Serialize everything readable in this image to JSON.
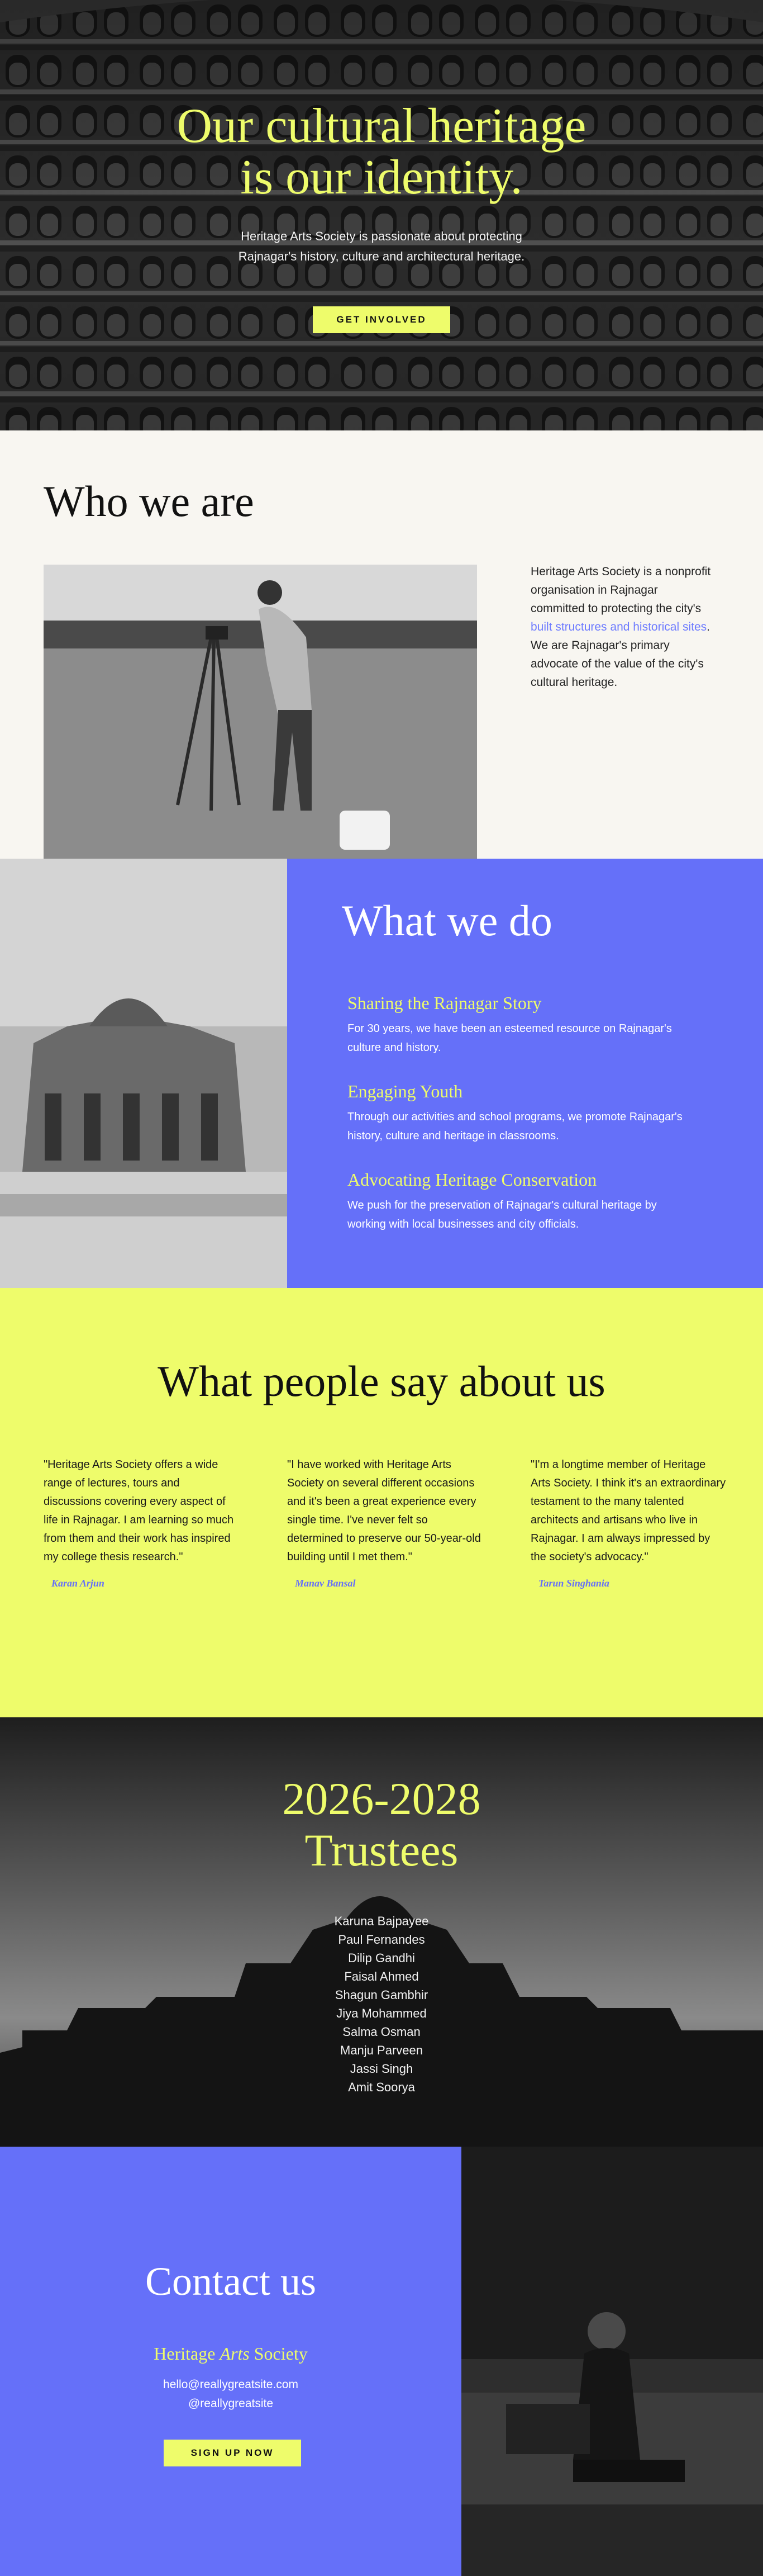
{
  "hero": {
    "title_line1": "Our cultural heritage",
    "title_line2": "is our identity.",
    "subtitle_line1": "Heritage Arts Society is passionate about protecting",
    "subtitle_line2": "Rajnagar's history, culture and architectural heritage.",
    "cta_label": "GET INVOLVED"
  },
  "who": {
    "heading": "Who we are",
    "desc_part1": "Heritage Arts Society is a nonprofit organisation in Rajnagar committed to protecting the city's ",
    "desc_link": "built structures and historical sites",
    "desc_part2": ". We are Rajnagar's primary advocate of the value of the city's cultural heritage."
  },
  "what_we_do": {
    "heading": "What we do",
    "items": [
      {
        "title": "Sharing the Rajnagar Story",
        "text": "For 30 years, we have been an esteemed resource on Rajnagar's culture and history."
      },
      {
        "title": "Engaging Youth",
        "text": "Through our activities and school programs, we promote Rajnagar's history, culture and heritage in classrooms."
      },
      {
        "title": "Advocating Heritage Conservation",
        "text": "We push for the preservation of Rajnagar's cultural heritage by working with local businesses and city officials."
      }
    ]
  },
  "testimonials": {
    "heading": "What people say about us",
    "items": [
      {
        "quote": "\"Heritage Arts Society offers a wide range of lectures, tours and discussions covering every aspect of life in Rajnagar. I am learning so much from them and their work has inspired my college thesis research.\"",
        "author": "Karan Arjun"
      },
      {
        "quote": "\"I have worked with Heritage Arts Society on several different occasions and it's been a great experience every single time. I've never felt so determined to preserve our 50-year-old building until I met them.\"",
        "author": "Manav Bansal"
      },
      {
        "quote": "\"I'm a longtime member of Heritage Arts Society. I think it's an extraordinary testament to the many talented architects and artisans who live in Rajnagar. I am always impressed by the society's advocacy.\"",
        "author": "Tarun Singhania"
      }
    ]
  },
  "trustees": {
    "heading_line1": "2026-2028",
    "heading_line2": "Trustees",
    "names": [
      "Karuna Bajpayee",
      "Paul Fernandes",
      "Dilip Gandhi",
      "Faisal Ahmed",
      "Shagun Gambhir",
      "Jiya Mohammed",
      "Salma Osman",
      "Manju Parveen",
      "Jassi Singh",
      "Amit Soorya"
    ]
  },
  "contact": {
    "heading": "Contact us",
    "org_part1": "Heritage ",
    "org_italic": "Arts",
    "org_part2": " Society",
    "email": "hello@reallygreatsite.com",
    "handle": "@reallygreatsite",
    "cta_label": "SIGN UP NOW"
  },
  "colors": {
    "accent_yellow": "#eefc6b",
    "accent_blue": "#6570f9",
    "cream": "#f8f6f1",
    "link": "#6d7bff"
  }
}
